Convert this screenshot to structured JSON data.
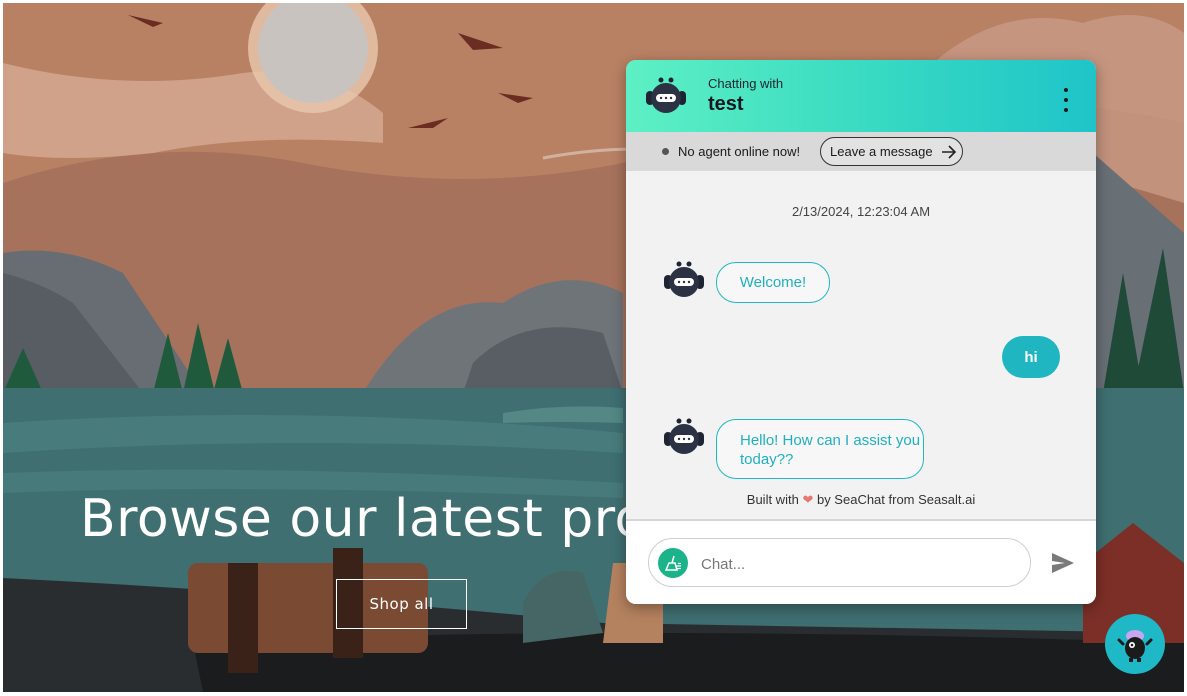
{
  "hero": {
    "heading": "Browse our latest prod",
    "shop_button": "Shop all"
  },
  "chat": {
    "header": {
      "subtitle": "Chatting with",
      "title": "test"
    },
    "status": {
      "text": "No agent online now!",
      "leave_message_label": "Leave a message"
    },
    "timestamp": "2/13/2024, 12:23:04 AM",
    "messages": [
      {
        "from": "bot",
        "text": "Welcome!"
      },
      {
        "from": "user",
        "text": "hi"
      },
      {
        "from": "bot",
        "text": "Hello! How can I assist you today??"
      }
    ],
    "footer": {
      "built_prefix": "Built with",
      "built_suffix": "by SeaChat from Seasalt.ai"
    },
    "input": {
      "placeholder": "Chat...",
      "value": ""
    },
    "icons": {
      "avatar": "robot-avatar-icon",
      "menu": "more-vertical-icon",
      "leave": "arrow-right-icon",
      "clear": "broom-icon",
      "send": "send-icon",
      "launcher": "mascot-icon"
    }
  },
  "colors": {
    "header_gradient_start": "#5ef0c4",
    "header_gradient_end": "#1fc4c9",
    "accent": "#1fb6c2",
    "broom_bg": "#1db38a"
  }
}
